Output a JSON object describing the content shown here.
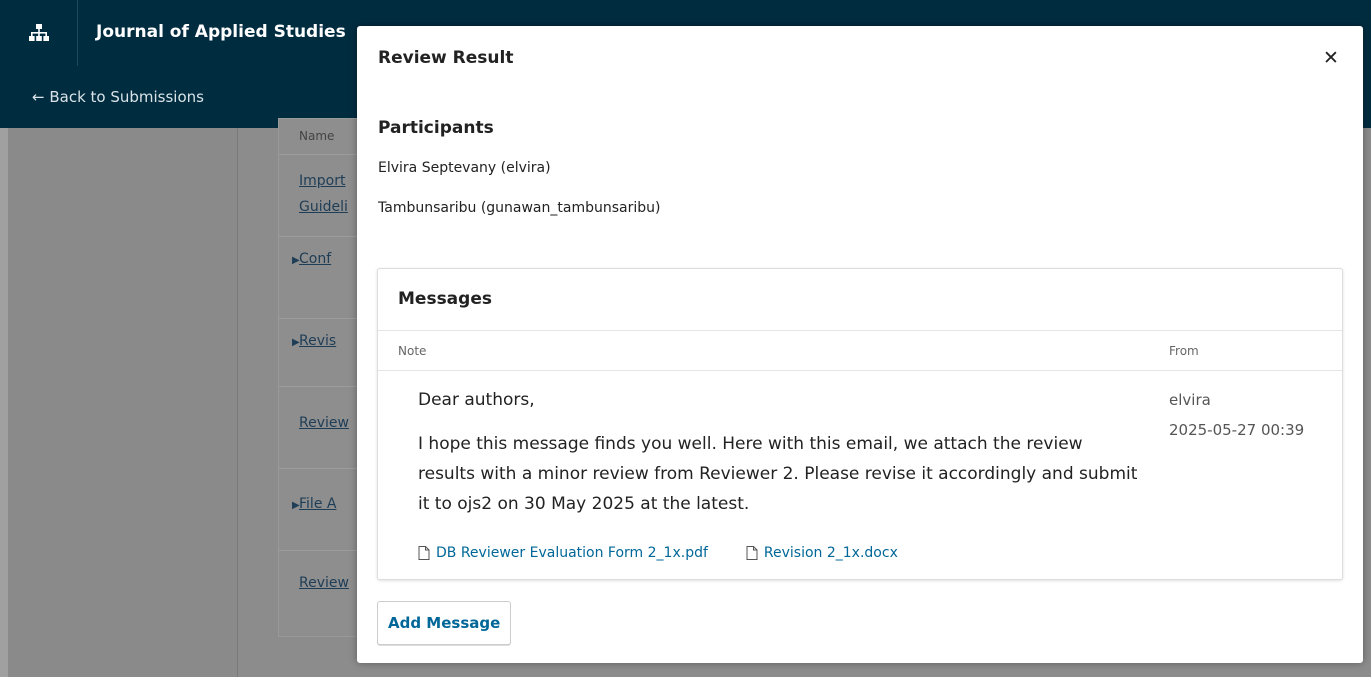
{
  "header": {
    "journal_title": "Journal of Applied Studies",
    "back_link": "← Back to Submissions"
  },
  "background_panel": {
    "column_header": "Name",
    "rows": [
      {
        "label": "Import",
        "toggle": false
      },
      {
        "label": "Guideli",
        "toggle": false
      },
      {
        "label": "Conf",
        "toggle": true
      },
      {
        "label": "Revis",
        "toggle": true
      },
      {
        "label": "Review",
        "toggle": false
      },
      {
        "label": "File A",
        "toggle": true
      },
      {
        "label": "Review",
        "toggle": false
      }
    ]
  },
  "modal": {
    "title": "Review Result",
    "close_icon": "close-icon",
    "participants_heading": "Participants",
    "participants": [
      "Elvira Septevany (elvira)",
      "Tambunsaribu (gunawan_tambunsaribu)"
    ],
    "messages": {
      "title": "Messages",
      "col_note": "Note",
      "col_from": "From",
      "items": [
        {
          "greeting": "Dear authors,",
          "body": "I hope this message finds you well. Here with this email, we attach the review results with a minor review from Reviewer 2. Please revise it accordingly and submit it to ojs2 on 30 May 2025 at the latest.",
          "from_user": "elvira",
          "from_date": "2025-05-27 00:39",
          "attachments": [
            "DB Reviewer Evaluation Form 2_1x.pdf",
            "Revision 2_1x.docx"
          ]
        }
      ]
    },
    "add_message_label": "Add Message"
  },
  "colors": {
    "header_bg": "#002c40",
    "link": "#006798",
    "overlay": "#8c8c8c"
  }
}
